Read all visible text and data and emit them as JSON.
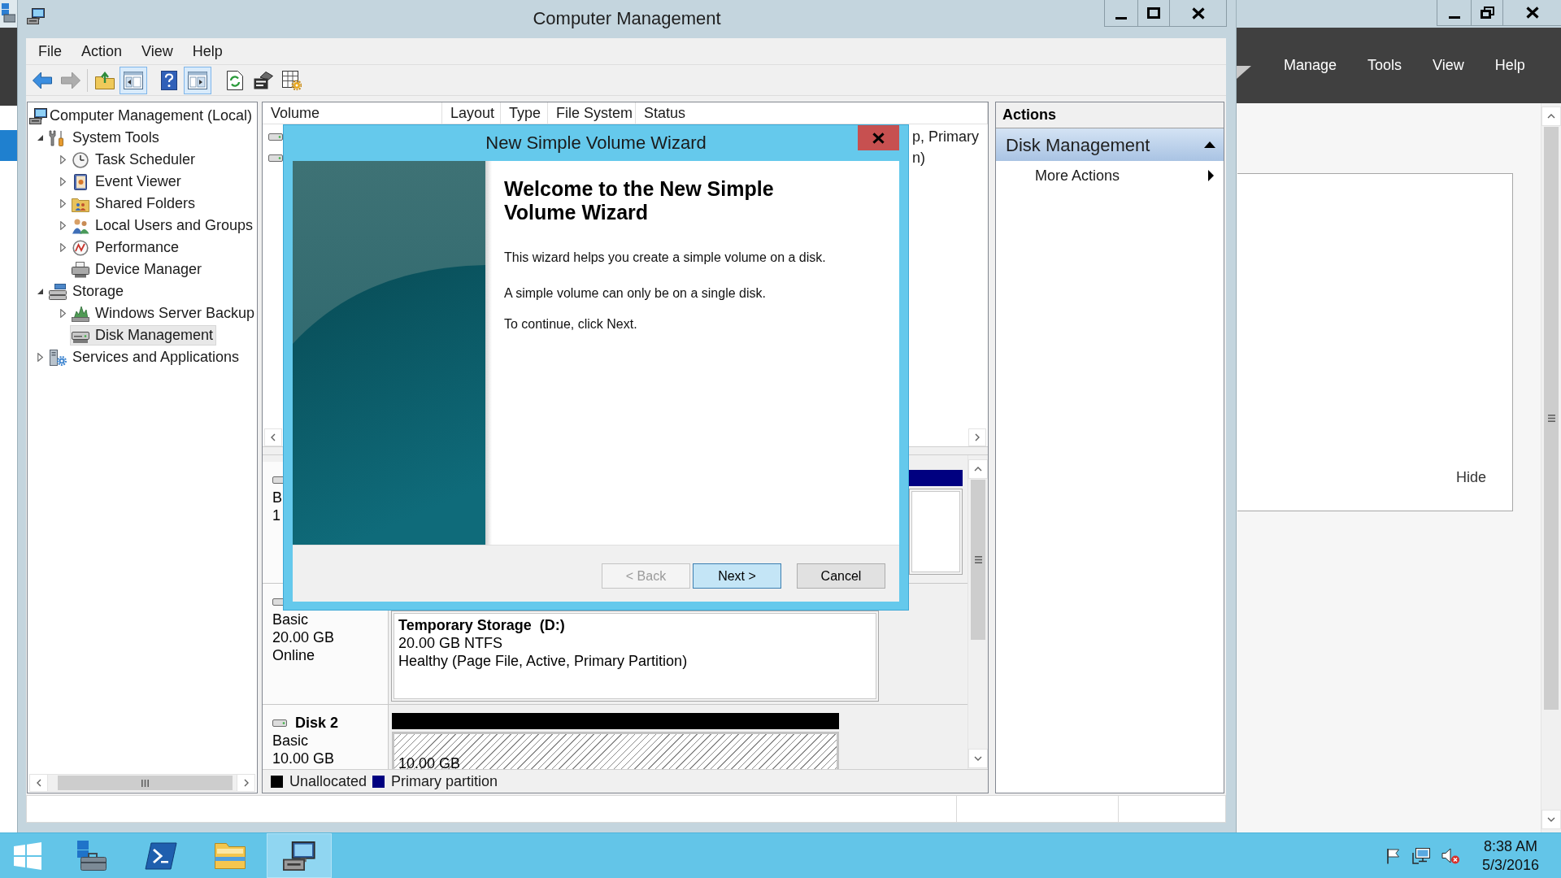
{
  "background_window": {
    "menu": [
      "Manage",
      "Tools",
      "View",
      "Help"
    ],
    "panel": {
      "link": "Hide"
    }
  },
  "window": {
    "title": "Computer Management"
  },
  "menu": [
    "File",
    "Action",
    "View",
    "Help"
  ],
  "toolbar": [
    {
      "disabled": false,
      "pressed": false
    },
    {
      "disabled": true,
      "pressed": false
    },
    {
      "disabled": false,
      "pressed": false
    },
    {
      "disabled": false,
      "pressed": true
    },
    {
      "disabled": false,
      "pressed": false
    },
    {
      "disabled": false,
      "pressed": true
    },
    {
      "disabled": false,
      "pressed": false
    },
    {
      "disabled": false,
      "pressed": false
    },
    {
      "disabled": false,
      "pressed": false
    }
  ],
  "tree": [
    {
      "label": "Computer Management (Local)",
      "selected": false,
      "children": [
        {
          "label": "System Tools",
          "selected": false,
          "expanded": true,
          "children": [
            {
              "label": "Task Scheduler",
              "selected": false,
              "expanded": false
            },
            {
              "label": "Event Viewer",
              "selected": false,
              "expanded": false
            },
            {
              "label": "Shared Folders",
              "selected": false,
              "expanded": false
            },
            {
              "label": "Local Users and Groups",
              "selected": false,
              "expanded": false
            },
            {
              "label": "Performance",
              "selected": false,
              "expanded": false
            },
            {
              "label": "Device Manager",
              "selected": false
            }
          ]
        },
        {
          "label": "Storage",
          "selected": false,
          "expanded": true,
          "children": [
            {
              "label": "Windows Server Backup",
              "selected": false,
              "expanded": false
            },
            {
              "label": "Disk Management",
              "selected": true
            }
          ]
        },
        {
          "label": "Services and Applications",
          "selected": false,
          "expanded": false
        }
      ]
    }
  ],
  "volume_table": {
    "columns": [
      "Volume",
      "Layout",
      "Type",
      "File System",
      "Status"
    ],
    "rows": [
      {
        "status": "p, Primary"
      },
      {
        "status": "n)"
      }
    ]
  },
  "disks": [
    {
      "lines": [
        "B",
        "1"
      ],
      "partitions": [
        {
          "kind": "primary",
          "color": "#000080"
        }
      ]
    },
    {
      "lines": [
        "Basic",
        "20.00 GB",
        "Online"
      ],
      "partitions": [
        {
          "kind": "primary",
          "title": "Temporary Storage  (D:)",
          "lines": [
            "20.00 GB NTFS",
            "Healthy (Page File, Active, Primary Partition)"
          ]
        }
      ]
    },
    {
      "name": "Disk 2",
      "lines": [
        "Basic",
        "10.00 GB"
      ],
      "partitions": [
        {
          "kind": "unallocated",
          "color": "#000000",
          "lines": [
            "10.00 GB"
          ]
        }
      ]
    }
  ],
  "legend": [
    {
      "label": "Unallocated",
      "color": "#000000"
    },
    {
      "label": "Primary partition",
      "color": "#000080"
    }
  ],
  "actions": {
    "title": "Actions",
    "sections": [
      {
        "title": "Disk Management",
        "expanded": true,
        "items": [
          {
            "label": "More Actions",
            "submenu": true
          }
        ]
      }
    ]
  },
  "dialog": {
    "title": "New Simple Volume Wizard",
    "heading": "Welcome to the New Simple Volume Wizard",
    "paragraphs": [
      "This wizard helps you create a simple volume on a disk.",
      "A simple volume can only be on a single disk.",
      "To continue, click Next."
    ],
    "buttons": [
      {
        "label": "< Back",
        "disabled": true,
        "focused": false
      },
      {
        "label": "Next >",
        "disabled": false,
        "focused": true
      },
      {
        "label": "Cancel",
        "disabled": false,
        "focused": false
      }
    ]
  },
  "taskbar": {
    "apps": [
      {
        "selected": false
      },
      {
        "selected": false
      },
      {
        "selected": false
      },
      {
        "selected": true
      }
    ],
    "time": "8:38 AM",
    "date": "5/3/2016"
  }
}
